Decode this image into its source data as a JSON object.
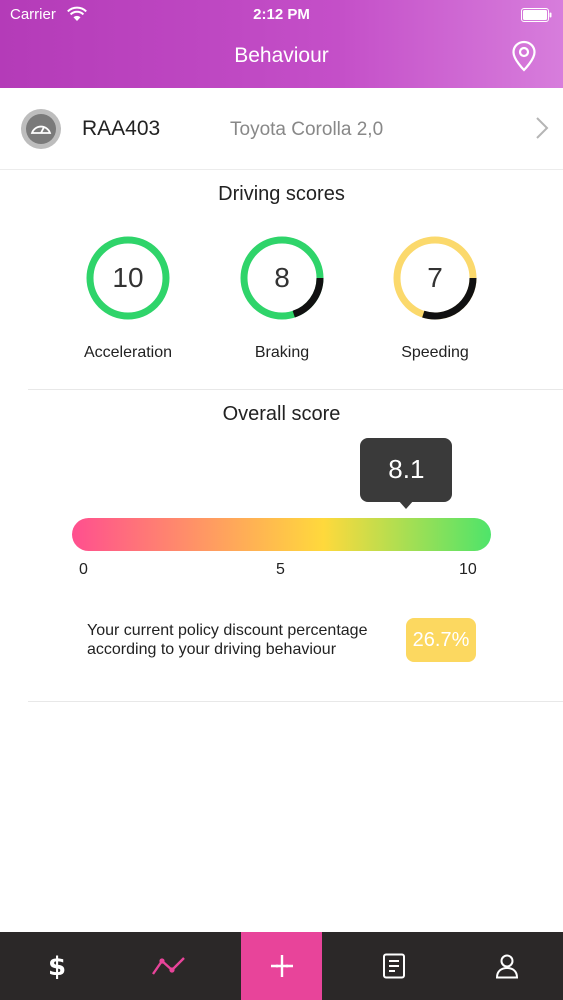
{
  "status_bar": {
    "carrier": "Carrier",
    "time": "2:12 PM"
  },
  "nav": {
    "title": "Behaviour",
    "right_icon": "location-pin-icon"
  },
  "vehicle": {
    "plate": "RAA403",
    "model": "Toyota Corolla 2,0",
    "icon": "speedometer-icon"
  },
  "driving_scores": {
    "title": "Driving scores",
    "items": [
      {
        "label": "Acceleration",
        "value": "10",
        "score": 10,
        "max": 10,
        "color": "#2fd46a"
      },
      {
        "label": "Braking",
        "value": "8",
        "score": 8,
        "max": 10,
        "color": "#2fd46a"
      },
      {
        "label": "Speeding",
        "value": "7",
        "score": 7,
        "max": 10,
        "color": "#fbd96c"
      }
    ]
  },
  "overall": {
    "title": "Overall score",
    "value": "8.1",
    "score": 8.1,
    "min_label": "0",
    "mid_label": "5",
    "max_label": "10",
    "gradient": [
      "#ff4f8f",
      "#ffd93c",
      "#4ee46a"
    ]
  },
  "discount": {
    "text": "Your current policy discount percentage according to your driving behaviour",
    "value": "26.7%",
    "color": "#fcd860"
  },
  "tabbar": {
    "tabs": [
      {
        "name": "tab-dollar",
        "icon": "dollar-icon"
      },
      {
        "name": "tab-behaviour",
        "icon": "trend-line-icon",
        "active": true,
        "color": "#e8449a"
      },
      {
        "name": "tab-add",
        "icon": "plus-icon"
      },
      {
        "name": "tab-documents",
        "icon": "document-icon"
      },
      {
        "name": "tab-profile",
        "icon": "person-icon"
      }
    ]
  }
}
